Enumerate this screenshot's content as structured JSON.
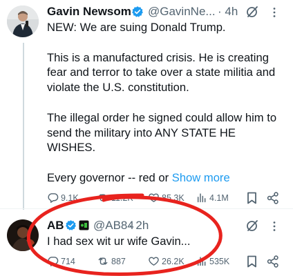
{
  "tweet1": {
    "name": "Gavin Newsom",
    "handle": "@GavinNe...",
    "time": "· 4h",
    "lines": [
      "NEW: We are suing Donald Trump.",
      "This is a manufactured crisis. He is creating",
      "fear and terror to take over a state militia and",
      "violate the U.S. constitution.",
      "The illegal order he signed could allow him to",
      "send the military into ANY STATE HE",
      "WISHES.",
      "Every governor -- red or"
    ],
    "show_more": "Show more",
    "actions": {
      "replies": "9.1K",
      "reposts": "11.2K",
      "likes": "85.3K",
      "views": "4.1M"
    }
  },
  "tweet2": {
    "name": "AB",
    "handle": "@AB84",
    "time": "· 2h",
    "text": "I had sex wit ur wife Gavin...",
    "actions": {
      "replies": "714",
      "reposts": "887",
      "likes": "26.2K",
      "views": "535K"
    }
  },
  "colors": {
    "verified_blue": "#1d9bf0",
    "link_blue": "#1d9bf0",
    "annotation_red": "#e8231e",
    "muted_text": "#536471"
  }
}
